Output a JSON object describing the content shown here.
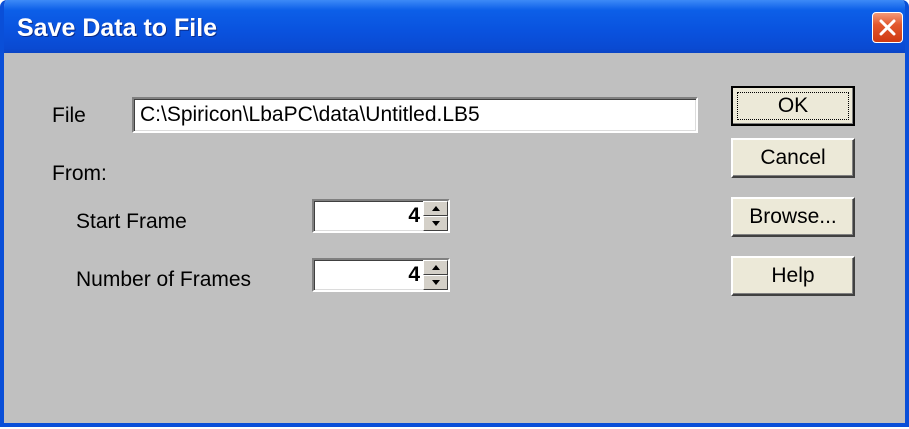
{
  "window": {
    "title": "Save Data to File",
    "close_icon": "close-icon"
  },
  "form": {
    "file_label": "File",
    "file_value": "C:\\Spiricon\\LbaPC\\data\\Untitled.LB5",
    "from_label": "From:",
    "start_frame_label": "Start Frame",
    "start_frame_value": "4",
    "num_frames_label": "Number of Frames",
    "num_frames_value": "4"
  },
  "buttons": {
    "ok": "OK",
    "cancel": "Cancel",
    "browse": "Browse...",
    "help": "Help"
  },
  "colors": {
    "titlebar": "#0a52de",
    "dialog_bg": "#c0c0c0",
    "close_button": "#e2582e"
  }
}
